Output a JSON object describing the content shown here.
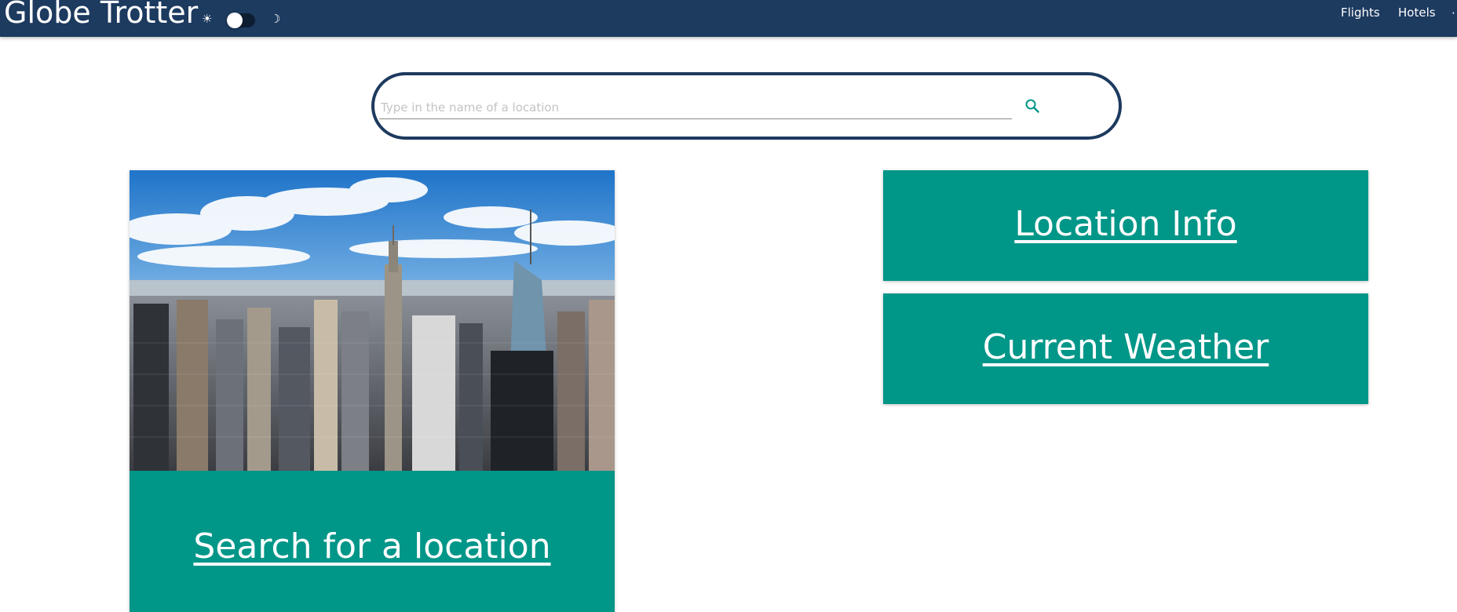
{
  "header": {
    "brand": "Globe Trotter",
    "theme_toggle": {
      "light_icon": "sun-icon",
      "dark_icon": "moon-icon",
      "light_glyph": "☀",
      "dark_glyph": "☽",
      "state": "light"
    },
    "nav": [
      {
        "label": "Flights"
      },
      {
        "label": "Hotels"
      }
    ]
  },
  "search": {
    "value": "",
    "placeholder": "Type in the name of a location",
    "icon": "search-icon"
  },
  "hero_card": {
    "image": "city-skyline-image",
    "link_label": "Search for a location"
  },
  "tiles": [
    {
      "label": "Location Info"
    },
    {
      "label": "Current Weather"
    }
  ],
  "colors": {
    "navbar": "#1d3a5f",
    "accent": "#009688",
    "search_border": "#1d3a5f",
    "text_on_accent": "#ffffff"
  }
}
